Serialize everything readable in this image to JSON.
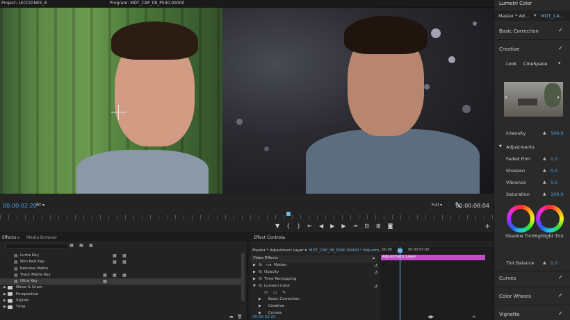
{
  "tabs": {
    "project": "Project: LECCIONES_8",
    "program": "Program: MDT_CAP_08_P040.00000"
  },
  "transport": {
    "timecode_left": "00:00:02:20",
    "fit": "Fit",
    "quality": "Full",
    "timecode_right": "00:00:08:04"
  },
  "effects_panel": {
    "tab_effects": "Effects",
    "tab_media": "Media Browser",
    "items": [
      {
        "label": "Luma Key",
        "type": "effect"
      },
      {
        "label": "Non Red Key",
        "type": "effect"
      },
      {
        "label": "Remove Matte",
        "type": "effect"
      },
      {
        "label": "Track Matte Key",
        "type": "effect"
      },
      {
        "label": "Ultra Key",
        "type": "effect",
        "selected": true
      },
      {
        "label": "Noise & Grain",
        "type": "folder"
      },
      {
        "label": "Perspective",
        "type": "folder"
      },
      {
        "label": "Stylize",
        "type": "folder"
      },
      {
        "label": "Time",
        "type": "folder"
      }
    ]
  },
  "effect_controls": {
    "title": "Effect Controls",
    "source": "Master * Adjustment Layer",
    "clip": "MDT_CAP_08_P040.00000 * Adjustm...",
    "ruler_start": ":00:00",
    "ruler_mid": "00:00:05:00",
    "layer_label": "Adjustment Layer",
    "timecode": "00:00:02:20",
    "rows": [
      {
        "label": "Video Effects"
      },
      {
        "label": "Motion",
        "fx": true
      },
      {
        "label": "Opacity",
        "fx": true
      },
      {
        "label": "Time Remapping",
        "fx": true
      },
      {
        "label": "Lumetri Color",
        "fx": true
      },
      {
        "label": "Basic Correction"
      },
      {
        "label": "Creative"
      },
      {
        "label": "Curves"
      }
    ]
  },
  "lumetri": {
    "title": "Lumetri Color",
    "master": "Master * Ad...",
    "clip": "MDT_CA...",
    "basic_correction": "Basic Correction",
    "creative": "Creative",
    "look_label": "Look",
    "look_value": "CineSpace",
    "intensity_label": "Intensity",
    "intensity_value": "100,0",
    "adjustments": "Adjustments",
    "faded_film_label": "Faded Film",
    "faded_film_value": "0,0",
    "sharpen_label": "Sharpen",
    "sharpen_value": "0,0",
    "vibrance_label": "Vibrance",
    "vibrance_value": "0,0",
    "saturation_label": "Saturation",
    "saturation_value": "100,0",
    "shadow_tint": "Shadow Tint",
    "highlight_tint": "Highlight Tint",
    "tint_balance_label": "Tint Balance",
    "tint_balance_value": "0,0",
    "curves": "Curves",
    "color_wheels": "Color Wheels",
    "vignette": "Vignette"
  }
}
